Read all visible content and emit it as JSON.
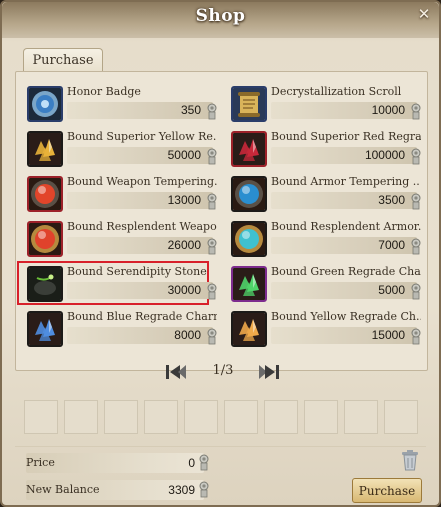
{
  "window": {
    "title": "Shop"
  },
  "tabs": [
    {
      "label": "Purchase"
    }
  ],
  "items": [
    {
      "name": "Honor Badge",
      "price": "350",
      "icon": "honor-badge-icon",
      "color": "#3b7fc4"
    },
    {
      "name": "Decrystallization Scroll",
      "price": "10000",
      "icon": "scroll-icon",
      "color": "#d9b45a"
    },
    {
      "name": "Bound Superior Yellow Re..",
      "price": "50000",
      "icon": "yellow-crystal-icon",
      "color": "#e8b23a"
    },
    {
      "name": "Bound Superior Red Regra..",
      "price": "100000",
      "icon": "red-crystal-icon",
      "color": "#c8283a"
    },
    {
      "name": "Bound Weapon Tempering..",
      "price": "13000",
      "icon": "red-orb-icon",
      "color": "#e2452a"
    },
    {
      "name": "Bound Armor Tempering ..",
      "price": "3500",
      "icon": "blue-orb-icon",
      "color": "#2a8ed0"
    },
    {
      "name": "Bound Resplendent Weapo..",
      "price": "26000",
      "icon": "red-orb-frame-icon",
      "color": "#e0422c"
    },
    {
      "name": "Bound Resplendent Armor..",
      "price": "7000",
      "icon": "cyan-orb-frame-icon",
      "color": "#3fc1cf"
    },
    {
      "name": "Bound Serendipity Stone",
      "price": "30000",
      "icon": "serendipity-stone-icon",
      "color": "#6bbf3a"
    },
    {
      "name": "Bound Green Regrade Cha..",
      "price": "5000",
      "icon": "green-crystal-icon",
      "color": "#4fd46a"
    },
    {
      "name": "Bound Blue Regrade Charm",
      "price": "8000",
      "icon": "blue-crystal-icon",
      "color": "#4f8de0"
    },
    {
      "name": "Bound Yellow Regrade Ch..",
      "price": "15000",
      "icon": "amber-crystal-icon",
      "color": "#f0a94a"
    }
  ],
  "selected_item": "Bound Serendipity Stone",
  "pager": {
    "label": "1/3"
  },
  "totals": {
    "price_label": "Price",
    "price_value": "0",
    "balance_label": "New Balance",
    "balance_value": "3309"
  },
  "buttons": {
    "purchase_label": "Purchase"
  },
  "colors": {
    "selection_border": "#d8202a",
    "accent_gold": "#d8b873"
  }
}
